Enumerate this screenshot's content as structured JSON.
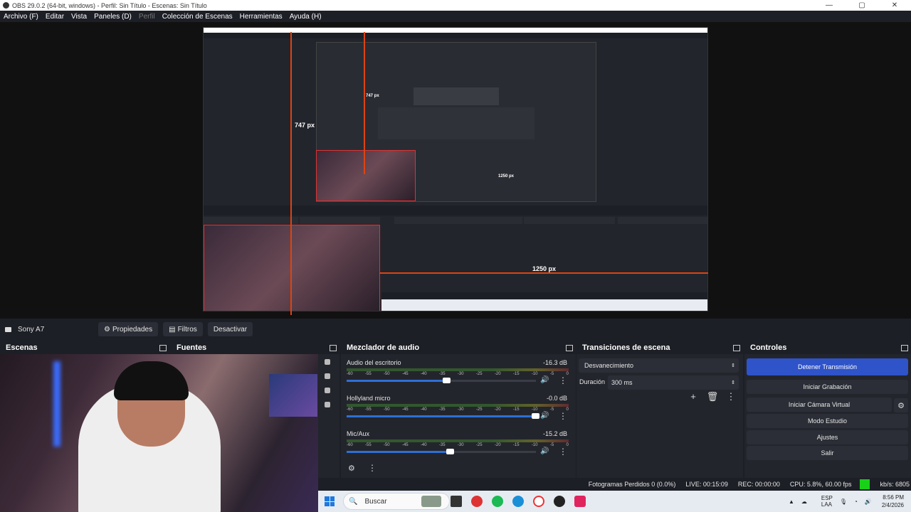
{
  "window": {
    "title": "OBS 29.0.2 (64-bit, windows) - Perfil: Sin Título - Escenas: Sin Título",
    "minimize": "—",
    "maximize": "▢",
    "close": "✕"
  },
  "menu": {
    "items": [
      "Archivo (F)",
      "Editar",
      "Vista",
      "Paneles (D)",
      "Perfil",
      "Colección de Escenas",
      "Herramientas",
      "Ayuda (H)"
    ]
  },
  "preview": {
    "measure_v": "747 px",
    "measure_h": "1250 px",
    "nested_measure_v": "747 px",
    "nested_measure_h": "1250 px"
  },
  "source_toolbar": {
    "source_name": "Sony A7",
    "properties": "Propiedades",
    "filters": "Filtros",
    "deactivate": "Desactivar"
  },
  "docks": {
    "scenes": "Escenas",
    "sources": "Fuentes",
    "mixer": "Mezclador de audio",
    "transitions": "Transiciones de escena",
    "controls": "Controles"
  },
  "mixer": {
    "ticks": [
      "-60",
      "-55",
      "-50",
      "-45",
      "-40",
      "-35",
      "-30",
      "-25",
      "-20",
      "-15",
      "-10",
      "-5",
      "0"
    ],
    "channels": [
      {
        "name": "Audio del escritorio",
        "db": "-16.3 dB",
        "volume": 0.53
      },
      {
        "name": "Hollyland micro",
        "db": "-0.0 dB",
        "volume": 1.0
      },
      {
        "name": "Mic/Aux",
        "db": "-15.2 dB",
        "volume": 0.55
      }
    ]
  },
  "transitions": {
    "selected": "Desvanecimiento",
    "duration_label": "Duración",
    "duration_value": "300 ms"
  },
  "controls": {
    "stop_stream": "Detener Transmisión",
    "start_recording": "Iniciar Grabación",
    "start_vcam": "Iniciar Cámara Virtual",
    "studio_mode": "Modo Estudio",
    "settings": "Ajustes",
    "exit": "Salir"
  },
  "status": {
    "dropped": "Fotogramas Perdidos 0 (0.0%)",
    "live": "LIVE: 00:15:09",
    "rec": "REC: 00:00:00",
    "cpu": "CPU: 5.8%, 60.00 fps",
    "kbs": "kb/s: 6805",
    "ok_color": "#19d119"
  },
  "taskbar": {
    "search": "Buscar",
    "lang1": "ESP",
    "lang2": "LAA",
    "time": "8:56 PM",
    "date": "2/4/2026"
  }
}
